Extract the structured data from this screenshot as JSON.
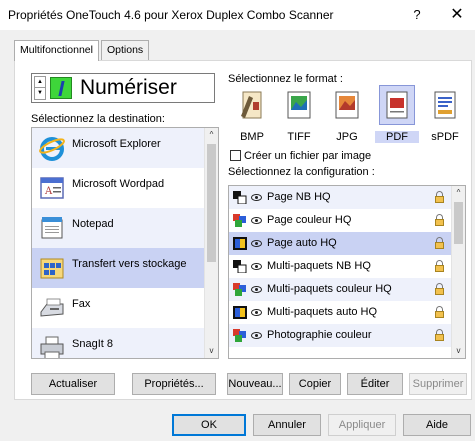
{
  "window": {
    "title": "Propriétés OneTouch 4.6 pour Xerox Duplex Combo Scanner",
    "help_label": "?",
    "close_label": "✕"
  },
  "tabs": [
    {
      "label": "Multifonctionnel",
      "active": true
    },
    {
      "label": "Options",
      "active": false
    }
  ],
  "scan_button": {
    "label": "Numériser",
    "icon": "scan-icon",
    "spin_up": "▲",
    "spin_down": "▼"
  },
  "destination": {
    "label": "Sélectionnez la destination:",
    "items": [
      {
        "label": "Microsoft Explorer",
        "icon": "internet-explorer-icon",
        "selected": false
      },
      {
        "label": "Microsoft Wordpad",
        "icon": "wordpad-icon",
        "selected": false
      },
      {
        "label": "Notepad",
        "icon": "notepad-icon",
        "selected": false
      },
      {
        "label": "Transfert vers stockage",
        "icon": "storage-transfer-icon",
        "selected": true
      },
      {
        "label": "Fax",
        "icon": "fax-icon",
        "selected": false
      },
      {
        "label": "SnagIt 8",
        "icon": "printer-icon",
        "selected": false
      }
    ],
    "scroll_up": "^",
    "scroll_down": "v"
  },
  "format": {
    "label": "Sélectionnez le format :",
    "items": [
      {
        "label": "BMP",
        "icon": "bmp-format-icon",
        "selected": false
      },
      {
        "label": "TIFF",
        "icon": "tiff-format-icon",
        "selected": false
      },
      {
        "label": "JPG",
        "icon": "jpg-format-icon",
        "selected": false
      },
      {
        "label": "PDF",
        "icon": "pdf-format-icon",
        "selected": true
      },
      {
        "label": "sPDF",
        "icon": "spdf-format-icon",
        "selected": false
      }
    ],
    "create_file_per_image": {
      "label": "Créer un fichier par image",
      "checked": false
    }
  },
  "configuration": {
    "label": "Sélectionnez la configuration :",
    "items": [
      {
        "label": "Page NB HQ",
        "icon": "bw-page-icon",
        "selected": false
      },
      {
        "label": "Page couleur HQ",
        "icon": "color-page-icon",
        "selected": false
      },
      {
        "label": "Page auto HQ",
        "icon": "auto-page-icon",
        "selected": true
      },
      {
        "label": "Multi-paquets NB HQ",
        "icon": "bw-page-icon",
        "selected": false
      },
      {
        "label": "Multi-paquets couleur HQ",
        "icon": "color-page-icon",
        "selected": false
      },
      {
        "label": "Multi-paquets auto HQ",
        "icon": "auto-page-icon",
        "selected": false
      },
      {
        "label": "Photographie couleur",
        "icon": "color-page-icon",
        "selected": false
      }
    ],
    "scroll_up": "^",
    "scroll_down": "v"
  },
  "buttons": {
    "refresh": "Actualiser",
    "properties": "Propriétés...",
    "new": "Nouveau...",
    "copy": "Copier",
    "edit": "Éditer",
    "delete": "Supprimer",
    "ok": "OK",
    "cancel": "Annuler",
    "apply": "Appliquer",
    "help": "Aide"
  }
}
